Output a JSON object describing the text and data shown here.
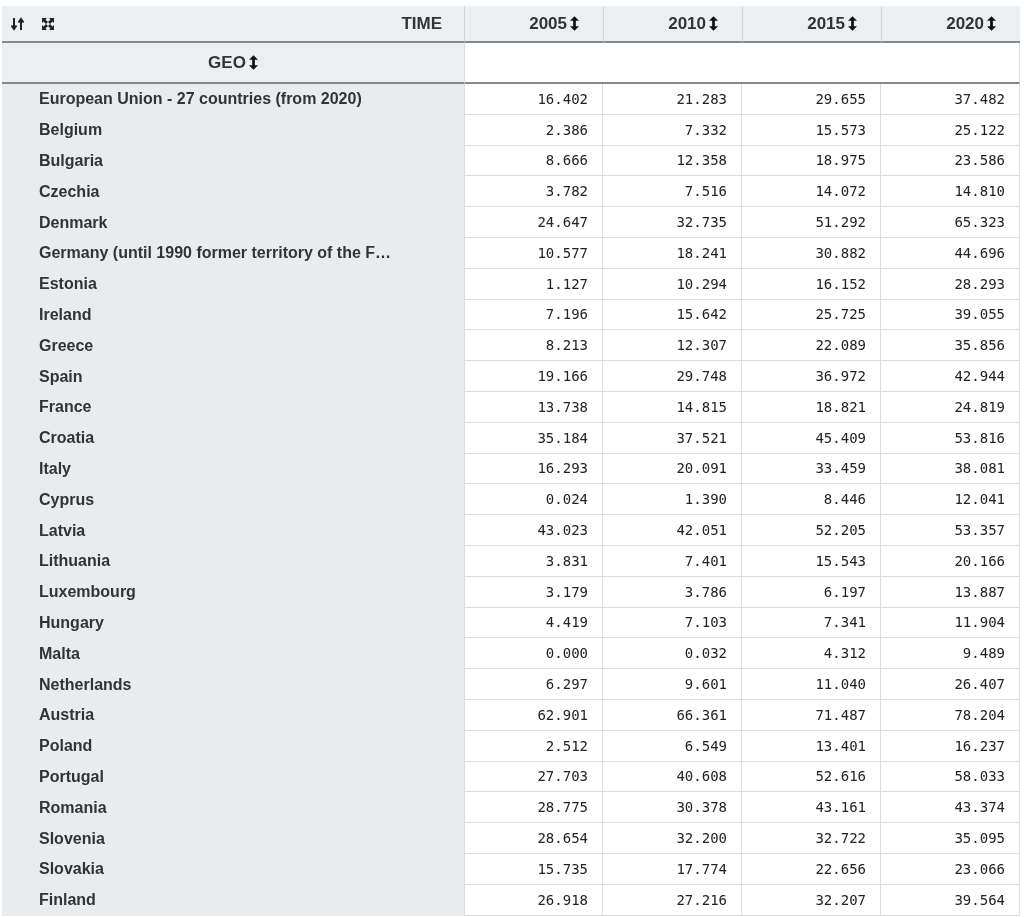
{
  "header": {
    "row_dimension": "GEO",
    "column_dimension": "TIME",
    "columns": [
      "2005",
      "2010",
      "2015",
      "2020"
    ]
  },
  "rows": [
    {
      "geo": "European Union - 27 countries (from 2020)",
      "values": [
        "16.402",
        "21.283",
        "29.655",
        "37.482"
      ]
    },
    {
      "geo": "Belgium",
      "values": [
        "2.386",
        "7.332",
        "15.573",
        "25.122"
      ]
    },
    {
      "geo": "Bulgaria",
      "values": [
        "8.666",
        "12.358",
        "18.975",
        "23.586"
      ]
    },
    {
      "geo": "Czechia",
      "values": [
        "3.782",
        "7.516",
        "14.072",
        "14.810"
      ]
    },
    {
      "geo": "Denmark",
      "values": [
        "24.647",
        "32.735",
        "51.292",
        "65.323"
      ]
    },
    {
      "geo": "Germany (until 1990 former territory of the F…",
      "values": [
        "10.577",
        "18.241",
        "30.882",
        "44.696"
      ]
    },
    {
      "geo": "Estonia",
      "values": [
        "1.127",
        "10.294",
        "16.152",
        "28.293"
      ]
    },
    {
      "geo": "Ireland",
      "values": [
        "7.196",
        "15.642",
        "25.725",
        "39.055"
      ]
    },
    {
      "geo": "Greece",
      "values": [
        "8.213",
        "12.307",
        "22.089",
        "35.856"
      ]
    },
    {
      "geo": "Spain",
      "values": [
        "19.166",
        "29.748",
        "36.972",
        "42.944"
      ]
    },
    {
      "geo": "France",
      "values": [
        "13.738",
        "14.815",
        "18.821",
        "24.819"
      ]
    },
    {
      "geo": "Croatia",
      "values": [
        "35.184",
        "37.521",
        "45.409",
        "53.816"
      ]
    },
    {
      "geo": "Italy",
      "values": [
        "16.293",
        "20.091",
        "33.459",
        "38.081"
      ]
    },
    {
      "geo": "Cyprus",
      "values": [
        "0.024",
        "1.390",
        "8.446",
        "12.041"
      ]
    },
    {
      "geo": "Latvia",
      "values": [
        "43.023",
        "42.051",
        "52.205",
        "53.357"
      ]
    },
    {
      "geo": "Lithuania",
      "values": [
        "3.831",
        "7.401",
        "15.543",
        "20.166"
      ]
    },
    {
      "geo": "Luxembourg",
      "values": [
        "3.179",
        "3.786",
        "6.197",
        "13.887"
      ]
    },
    {
      "geo": "Hungary",
      "values": [
        "4.419",
        "7.103",
        "7.341",
        "11.904"
      ]
    },
    {
      "geo": "Malta",
      "values": [
        "0.000",
        "0.032",
        "4.312",
        "9.489"
      ]
    },
    {
      "geo": "Netherlands",
      "values": [
        "6.297",
        "9.601",
        "11.040",
        "26.407"
      ]
    },
    {
      "geo": "Austria",
      "values": [
        "62.901",
        "66.361",
        "71.487",
        "78.204"
      ]
    },
    {
      "geo": "Poland",
      "values": [
        "2.512",
        "6.549",
        "13.401",
        "16.237"
      ]
    },
    {
      "geo": "Portugal",
      "values": [
        "27.703",
        "40.608",
        "52.616",
        "58.033"
      ]
    },
    {
      "geo": "Romania",
      "values": [
        "28.775",
        "30.378",
        "43.161",
        "43.374"
      ]
    },
    {
      "geo": "Slovenia",
      "values": [
        "28.654",
        "32.200",
        "32.722",
        "35.095"
      ]
    },
    {
      "geo": "Slovakia",
      "values": [
        "15.735",
        "17.774",
        "22.656",
        "23.066"
      ]
    },
    {
      "geo": "Finland",
      "values": [
        "26.918",
        "27.216",
        "32.207",
        "39.564"
      ]
    }
  ]
}
